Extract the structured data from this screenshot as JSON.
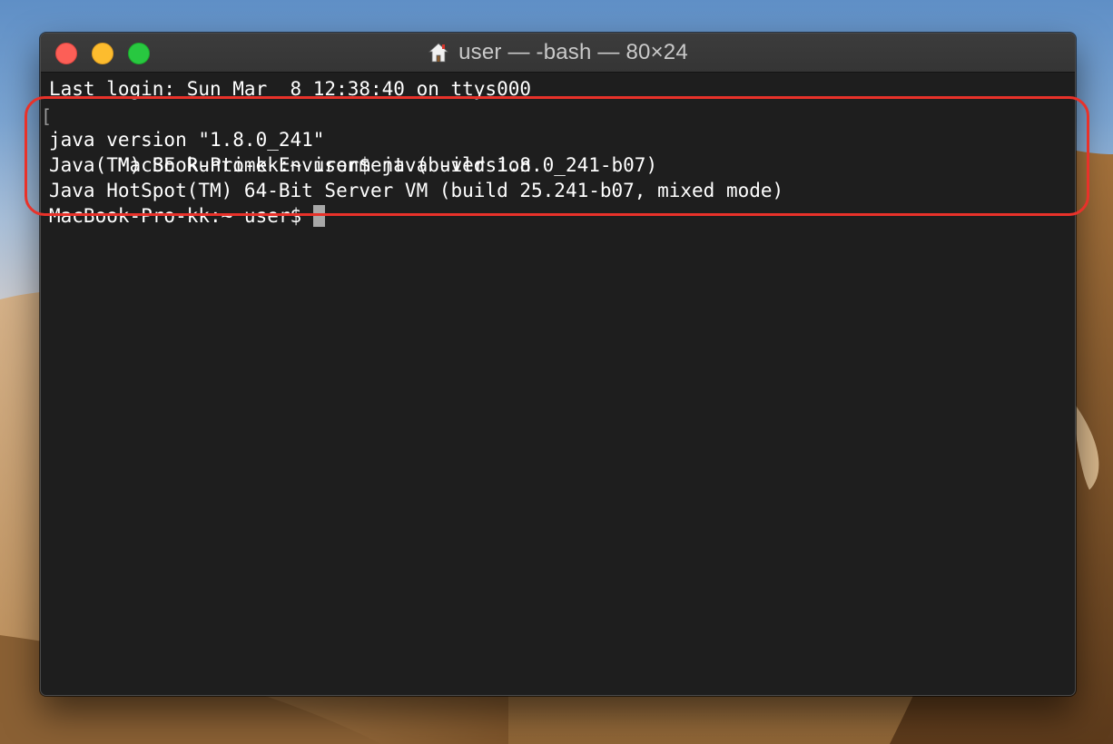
{
  "window": {
    "title": "user — -bash — 80×24"
  },
  "terminal": {
    "lines": [
      "Last login: Sun Mar  8 12:38:40 on ttys000",
      "MacBook-Pro-kk:~ user$ java -version",
      "java version \"1.8.0_241\"",
      "Java(TM) SE Runtime Environment (build 1.8.0_241-b07)",
      "Java HotSpot(TM) 64-Bit Server VM (build 25.241-b07, mixed mode)",
      "MacBook-Pro-kk:~ user$ "
    ],
    "mark_left": "[",
    "mark_right": "]"
  },
  "colors": {
    "annotation": "#e8322a",
    "terminal_bg": "#1e1e1e",
    "text": "#ffffff"
  },
  "icons": {
    "title_icon": "home-icon",
    "traffic_lights": [
      "close-icon",
      "minimize-icon",
      "zoom-icon"
    ]
  }
}
